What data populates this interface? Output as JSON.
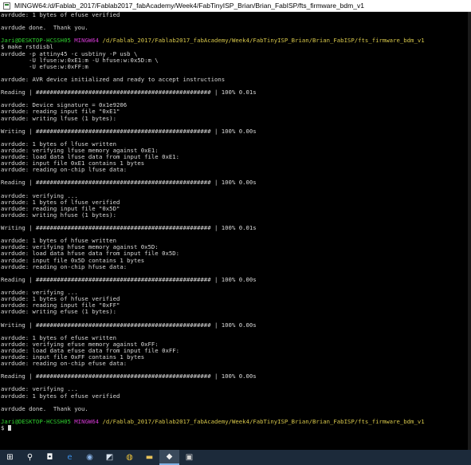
{
  "window": {
    "title": "MINGW64:/d/Fablab_2017/Fablab2017_fabAcademy/Week4/FabTinyISP_Brian/Brian_FabISP/fts_firmware_bdm_v1"
  },
  "terminal": {
    "lines": [
      {
        "parts": [
          {
            "t": "avrdude: 1 bytes of efuse verified"
          }
        ]
      },
      {
        "parts": [
          {
            "t": ""
          }
        ]
      },
      {
        "parts": [
          {
            "t": "avrdude done.  Thank you."
          }
        ]
      },
      {
        "parts": [
          {
            "t": ""
          }
        ]
      },
      {
        "parts": [
          {
            "t": "Jari@DESKTOP-HCSSH05",
            "c": "pg"
          },
          {
            "t": " "
          },
          {
            "t": "MINGW64",
            "c": "pm"
          },
          {
            "t": " "
          },
          {
            "t": "/d/Fablab_2017/Fablab2017_fabAcademy/Week4/FabTinyISP_Brian/Brian_FabISP/fts_firmware_bdm_v1",
            "c": "py"
          }
        ]
      },
      {
        "parts": [
          {
            "t": "$ make rstdisbl"
          }
        ]
      },
      {
        "parts": [
          {
            "t": "avrdude -p attiny45 -c usbtiny -P usb \\"
          }
        ]
      },
      {
        "parts": [
          {
            "t": "        -U lfuse:w:0xE1:m -U hfuse:w:0x5D:m \\"
          }
        ]
      },
      {
        "parts": [
          {
            "t": "        -U efuse:w:0xFF:m"
          }
        ]
      },
      {
        "parts": [
          {
            "t": ""
          }
        ]
      },
      {
        "parts": [
          {
            "t": "avrdude: AVR device initialized and ready to accept instructions"
          }
        ]
      },
      {
        "parts": [
          {
            "t": ""
          }
        ]
      },
      {
        "parts": [
          {
            "t": "Reading | ################################################## | 100% 0.01s"
          }
        ]
      },
      {
        "parts": [
          {
            "t": ""
          }
        ]
      },
      {
        "parts": [
          {
            "t": "avrdude: Device signature = 0x1e9206"
          }
        ]
      },
      {
        "parts": [
          {
            "t": "avrdude: reading input file \"0xE1\""
          }
        ]
      },
      {
        "parts": [
          {
            "t": "avrdude: writing lfuse (1 bytes):"
          }
        ]
      },
      {
        "parts": [
          {
            "t": ""
          }
        ]
      },
      {
        "parts": [
          {
            "t": "Writing | ################################################## | 100% 0.00s"
          }
        ]
      },
      {
        "parts": [
          {
            "t": ""
          }
        ]
      },
      {
        "parts": [
          {
            "t": "avrdude: 1 bytes of lfuse written"
          }
        ]
      },
      {
        "parts": [
          {
            "t": "avrdude: verifying lfuse memory against 0xE1:"
          }
        ]
      },
      {
        "parts": [
          {
            "t": "avrdude: load data lfuse data from input file 0xE1:"
          }
        ]
      },
      {
        "parts": [
          {
            "t": "avrdude: input file 0xE1 contains 1 bytes"
          }
        ]
      },
      {
        "parts": [
          {
            "t": "avrdude: reading on-chip lfuse data:"
          }
        ]
      },
      {
        "parts": [
          {
            "t": ""
          }
        ]
      },
      {
        "parts": [
          {
            "t": "Reading | ################################################## | 100% 0.00s"
          }
        ]
      },
      {
        "parts": [
          {
            "t": ""
          }
        ]
      },
      {
        "parts": [
          {
            "t": "avrdude: verifying ..."
          }
        ]
      },
      {
        "parts": [
          {
            "t": "avrdude: 1 bytes of lfuse verified"
          }
        ]
      },
      {
        "parts": [
          {
            "t": "avrdude: reading input file \"0x5D\""
          }
        ]
      },
      {
        "parts": [
          {
            "t": "avrdude: writing hfuse (1 bytes):"
          }
        ]
      },
      {
        "parts": [
          {
            "t": ""
          }
        ]
      },
      {
        "parts": [
          {
            "t": "Writing | ################################################## | 100% 0.01s"
          }
        ]
      },
      {
        "parts": [
          {
            "t": ""
          }
        ]
      },
      {
        "parts": [
          {
            "t": "avrdude: 1 bytes of hfuse written"
          }
        ]
      },
      {
        "parts": [
          {
            "t": "avrdude: verifying hfuse memory against 0x5D:"
          }
        ]
      },
      {
        "parts": [
          {
            "t": "avrdude: load data hfuse data from input file 0x5D:"
          }
        ]
      },
      {
        "parts": [
          {
            "t": "avrdude: input file 0x5D contains 1 bytes"
          }
        ]
      },
      {
        "parts": [
          {
            "t": "avrdude: reading on-chip hfuse data:"
          }
        ]
      },
      {
        "parts": [
          {
            "t": ""
          }
        ]
      },
      {
        "parts": [
          {
            "t": "Reading | ################################################## | 100% 0.00s"
          }
        ]
      },
      {
        "parts": [
          {
            "t": ""
          }
        ]
      },
      {
        "parts": [
          {
            "t": "avrdude: verifying ..."
          }
        ]
      },
      {
        "parts": [
          {
            "t": "avrdude: 1 bytes of hfuse verified"
          }
        ]
      },
      {
        "parts": [
          {
            "t": "avrdude: reading input file \"0xFF\""
          }
        ]
      },
      {
        "parts": [
          {
            "t": "avrdude: writing efuse (1 bytes):"
          }
        ]
      },
      {
        "parts": [
          {
            "t": ""
          }
        ]
      },
      {
        "parts": [
          {
            "t": "Writing | ################################################## | 100% 0.00s"
          }
        ]
      },
      {
        "parts": [
          {
            "t": ""
          }
        ]
      },
      {
        "parts": [
          {
            "t": "avrdude: 1 bytes of efuse written"
          }
        ]
      },
      {
        "parts": [
          {
            "t": "avrdude: verifying efuse memory against 0xFF:"
          }
        ]
      },
      {
        "parts": [
          {
            "t": "avrdude: load data efuse data from input file 0xFF:"
          }
        ]
      },
      {
        "parts": [
          {
            "t": "avrdude: input file 0xFF contains 1 bytes"
          }
        ]
      },
      {
        "parts": [
          {
            "t": "avrdude: reading on-chip efuse data:"
          }
        ]
      },
      {
        "parts": [
          {
            "t": ""
          }
        ]
      },
      {
        "parts": [
          {
            "t": "Reading | ################################################## | 100% 0.00s"
          }
        ]
      },
      {
        "parts": [
          {
            "t": ""
          }
        ]
      },
      {
        "parts": [
          {
            "t": "avrdude: verifying ..."
          }
        ]
      },
      {
        "parts": [
          {
            "t": "avrdude: 1 bytes of efuse verified"
          }
        ]
      },
      {
        "parts": [
          {
            "t": ""
          }
        ]
      },
      {
        "parts": [
          {
            "t": "avrdude done.  Thank you."
          }
        ]
      },
      {
        "parts": [
          {
            "t": ""
          }
        ]
      },
      {
        "parts": [
          {
            "t": "Jari@DESKTOP-HCSSH05",
            "c": "pg"
          },
          {
            "t": " "
          },
          {
            "t": "MINGW64",
            "c": "pm"
          },
          {
            "t": " "
          },
          {
            "t": "/d/Fablab_2017/Fablab2017_fabAcademy/Week4/FabTinyISP_Brian/Brian_FabISP/fts_firmware_bdm_v1",
            "c": "py"
          }
        ]
      },
      {
        "parts": [
          {
            "t": "$ "
          }
        ],
        "cursor": true
      }
    ]
  },
  "taskbar": {
    "items": [
      {
        "name": "start-button-windows-icon",
        "glyph": "⊞",
        "color": "#ffffff",
        "active": false
      },
      {
        "name": "search-icon",
        "glyph": "⚲",
        "color": "#ffffff",
        "active": false
      },
      {
        "name": "store-icon",
        "glyph": "◘",
        "color": "#ffffff",
        "active": false
      },
      {
        "name": "edge-browser-icon",
        "glyph": "e",
        "color": "#3a8ee6",
        "active": false
      },
      {
        "name": "app-icon",
        "glyph": "◉",
        "color": "#8ab4e8",
        "active": false
      },
      {
        "name": "terminal-app-icon",
        "glyph": "◩",
        "color": "#dce6f2",
        "active": false
      },
      {
        "name": "chrome-icon",
        "glyph": "◍",
        "color": "#e9c13a",
        "active": false
      },
      {
        "name": "file-explorer-icon",
        "glyph": "▬",
        "color": "#e8c35a",
        "active": false
      },
      {
        "name": "git-bash-icon",
        "glyph": "◆",
        "color": "#f0f0f0",
        "active": true
      },
      {
        "name": "usb-device-icon",
        "glyph": "▣",
        "color": "#d0d0d0",
        "active": false
      }
    ]
  }
}
